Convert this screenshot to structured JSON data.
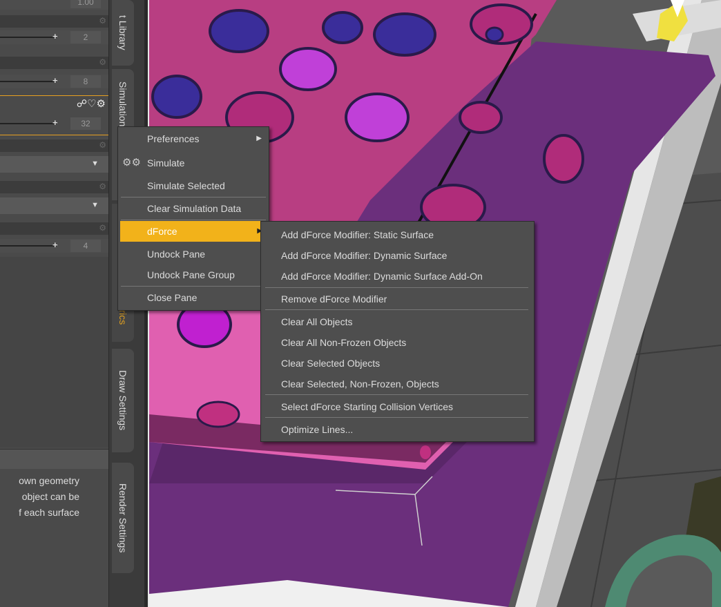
{
  "left_panel": {
    "rows": [
      {
        "type": "slider",
        "value": "1.00"
      },
      {
        "type": "slider",
        "value": "2"
      },
      {
        "type": "slider",
        "value": "8"
      },
      {
        "type": "slider",
        "value": "32",
        "icons": "&#9901;&#9825;&#9881;"
      },
      {
        "type": "dropdown"
      },
      {
        "type": "dropdown"
      },
      {
        "type": "slider",
        "value": "4"
      }
    ],
    "description_lines": [
      "own geometry",
      "object can be",
      "f each surface"
    ]
  },
  "tabs": [
    {
      "label": "t Library"
    },
    {
      "label": "Simulation Settings",
      "active": false
    },
    {
      "label": "Surface Metrics",
      "active": true
    },
    {
      "label": "Draw Settings"
    },
    {
      "label": "Render Settings"
    }
  ],
  "context_menu": {
    "items": [
      {
        "label": "Preferences",
        "submenu": true
      },
      {
        "label": "Simulate",
        "icon": "gears-icon"
      },
      {
        "label": "Simulate Selected"
      },
      {
        "label": "Clear Simulation Data"
      },
      {
        "label": "dForce",
        "submenu": true,
        "highlighted": true
      },
      {
        "label": "Undock Pane"
      },
      {
        "label": "Undock Pane Group"
      },
      {
        "label": "Close Pane"
      }
    ]
  },
  "dforce_submenu": {
    "items": [
      "Add dForce Modifier: Static Surface",
      "Add dForce Modifier: Dynamic Surface",
      "Add dForce Modifier: Dynamic Surface Add-On",
      "Remove dForce Modifier",
      "Clear All Objects",
      "Clear All Non-Frozen Objects",
      "Clear Selected Objects",
      "Clear Selected, Non-Frozen, Objects",
      "Select dForce Starting Collision Vertices",
      "Optimize Lines..."
    ]
  },
  "colors": {
    "accent": "#f2b21a",
    "menu_bg": "#4e4e4e",
    "fabric": "#b83e82",
    "sofa": "#6b2f7c"
  }
}
